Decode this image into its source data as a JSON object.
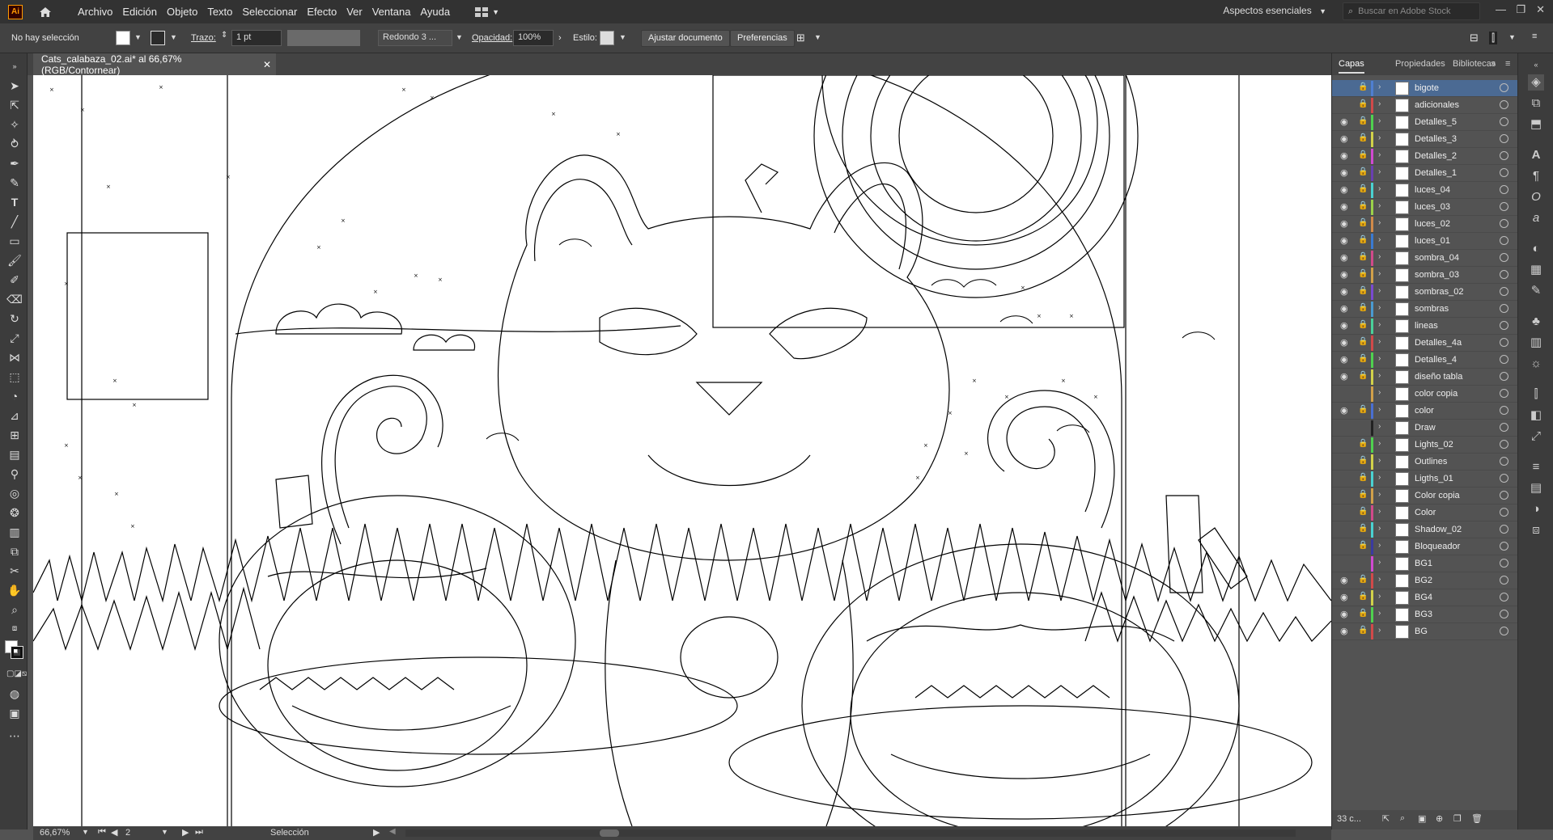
{
  "menubar": {
    "logo": "Ai",
    "items": [
      "Archivo",
      "Edición",
      "Objeto",
      "Texto",
      "Seleccionar",
      "Efecto",
      "Ver",
      "Ventana",
      "Ayuda"
    ],
    "workspace": "Aspectos esenciales",
    "stock_search_placeholder": "Buscar en Adobe Stock"
  },
  "controlbar": {
    "selection": "No hay selección",
    "stroke_label": "Trazo:",
    "stroke_value": "1 pt",
    "profile": "Redondo 3 ...",
    "opacity_label": "Opacidad:",
    "opacity_value": "100%",
    "style_label": "Estilo:",
    "fit_button": "Ajustar documento",
    "prefs_button": "Preferencias"
  },
  "document_tab": {
    "title": "Cats_calabaza_02.ai* al 66,67% (RGB/Contornear)"
  },
  "statusbar": {
    "zoom": "66,67%",
    "artboard": "2",
    "tool": "Selección"
  },
  "layers_panel": {
    "tabs": [
      "Capas",
      "Propiedades",
      "Bibliotecas"
    ],
    "layers": [
      {
        "name": "bigote",
        "color": "#4f7fd1",
        "visible": false,
        "locked": true
      },
      {
        "name": "adicionales",
        "color": "#d14a4a",
        "visible": false,
        "locked": true
      },
      {
        "name": "Detalles_5",
        "color": "#4fd14f",
        "visible": true,
        "locked": true
      },
      {
        "name": "Detalles_3",
        "color": "#d1d14a",
        "visible": true,
        "locked": true
      },
      {
        "name": "Detalles_2",
        "color": "#d14ad1",
        "visible": true,
        "locked": true
      },
      {
        "name": "Detalles_1",
        "color": "#6a3fb0",
        "visible": true,
        "locked": true
      },
      {
        "name": "luces_04",
        "color": "#4ad1d1",
        "visible": true,
        "locked": true
      },
      {
        "name": "luces_03",
        "color": "#9ad14a",
        "visible": true,
        "locked": true
      },
      {
        "name": "luces_02",
        "color": "#d18a4a",
        "visible": true,
        "locked": true
      },
      {
        "name": "luces_01",
        "color": "#3a7ad1",
        "visible": true,
        "locked": true
      },
      {
        "name": "sombra_04",
        "color": "#d14a8a",
        "visible": true,
        "locked": true
      },
      {
        "name": "sombra_03",
        "color": "#d1a04a",
        "visible": true,
        "locked": true
      },
      {
        "name": "sombras_02",
        "color": "#7a4ad1",
        "visible": true,
        "locked": true
      },
      {
        "name": "sombras",
        "color": "#4a9ad1",
        "visible": true,
        "locked": true
      },
      {
        "name": "lineas",
        "color": "#4ad19a",
        "visible": true,
        "locked": true
      },
      {
        "name": "Detalles_4a",
        "color": "#d14a4a",
        "visible": true,
        "locked": true
      },
      {
        "name": "Detalles_4",
        "color": "#4fd14f",
        "visible": true,
        "locked": true
      },
      {
        "name": "diseño tabla",
        "color": "#d1d14a",
        "visible": true,
        "locked": true
      },
      {
        "name": "color copia",
        "color": "#d1a04a",
        "visible": false,
        "locked": false
      },
      {
        "name": "color",
        "color": "#4a6fd1",
        "visible": true,
        "locked": true
      },
      {
        "name": "Draw",
        "color": "#222222",
        "visible": false,
        "locked": false
      },
      {
        "name": "Lights_02",
        "color": "#4fd14f",
        "visible": false,
        "locked": true
      },
      {
        "name": "Outlines",
        "color": "#d1d14a",
        "visible": false,
        "locked": true
      },
      {
        "name": "Ligths_01",
        "color": "#4ad1d1",
        "visible": false,
        "locked": true
      },
      {
        "name": "Color copia",
        "color": "#d1a04a",
        "visible": false,
        "locked": true
      },
      {
        "name": "Color",
        "color": "#d14a8a",
        "visible": false,
        "locked": true
      },
      {
        "name": "Shadow_02",
        "color": "#4ad1d1",
        "visible": false,
        "locked": true
      },
      {
        "name": "Bloqueador",
        "color": "#3a3aa0",
        "visible": false,
        "locked": true
      },
      {
        "name": "BG1",
        "color": "#d14ad1",
        "visible": false,
        "locked": false
      },
      {
        "name": "BG2",
        "color": "#d14a4a",
        "visible": true,
        "locked": true
      },
      {
        "name": "BG4",
        "color": "#d1d14a",
        "visible": true,
        "locked": true
      },
      {
        "name": "BG3",
        "color": "#4fd14f",
        "visible": true,
        "locked": true
      },
      {
        "name": "BG",
        "color": "#d14a4a",
        "visible": true,
        "locked": true
      }
    ],
    "footer_count": "33 c..."
  }
}
